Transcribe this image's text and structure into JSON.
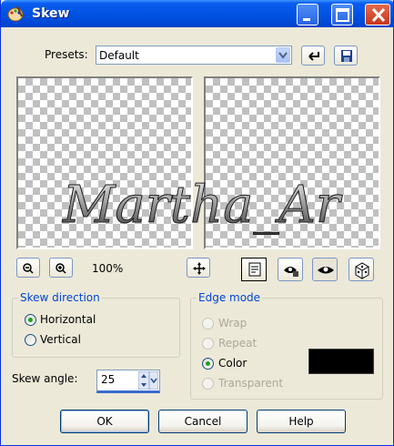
{
  "window": {
    "title": "Skew"
  },
  "presets": {
    "label": "Presets:",
    "value": "Default"
  },
  "zoom": {
    "level": "100%"
  },
  "watermark": {
    "text": "Martha_Ar"
  },
  "skew_direction": {
    "legend": "Skew direction",
    "options": [
      "Horizontal",
      "Vertical"
    ],
    "selected": "Horizontal"
  },
  "edge_mode": {
    "legend": "Edge mode",
    "options": [
      "Wrap",
      "Repeat",
      "Color",
      "Transparent"
    ],
    "selected": "Color",
    "color": "#000000"
  },
  "skew_angle": {
    "label": "Skew angle:",
    "value": "25"
  },
  "buttons": {
    "ok": "OK",
    "cancel": "Cancel",
    "help": "Help"
  }
}
